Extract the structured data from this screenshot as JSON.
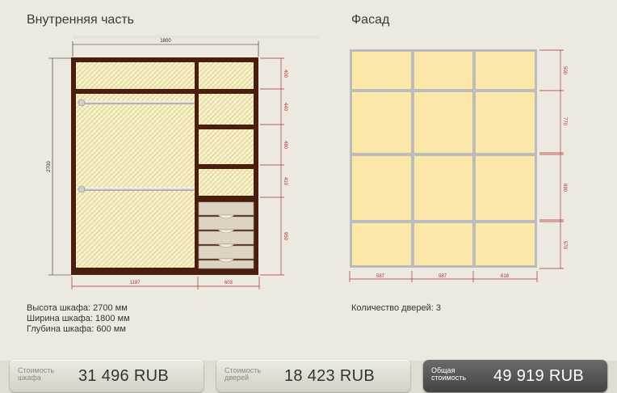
{
  "interior": {
    "title": "Внутренняя часть"
  },
  "facade": {
    "title": "Фасад"
  },
  "dimensions": {
    "interior_width": "1800",
    "interior_height": "2700",
    "bottom_left": "1197",
    "bottom_right": "603",
    "right_segments": [
      "400",
      "440",
      "480",
      "410",
      "950"
    ],
    "facade_right": [
      "500",
      "770",
      "890",
      "570"
    ],
    "facade_bottom": [
      "587",
      "587",
      "618"
    ]
  },
  "specs": {
    "height": "Высота шкафа: 2700 мм",
    "width": "Ширина шкафа: 1800 мм",
    "depth": "Глубина шкафа: 600 мм"
  },
  "doors_count": "Количество дверей: 3",
  "costs": {
    "cabinet": {
      "label1": "Стоимость",
      "label2": "шкафа",
      "value": "31 496  RUB"
    },
    "doors": {
      "label1": "Стоимость",
      "label2": "дверей",
      "value": "18 423  RUB"
    },
    "total": {
      "label1": "Общая",
      "label2": "стоимость",
      "value": "49 919  RUB"
    }
  },
  "colors": {
    "frame": "#4a1e0f",
    "panel": "#fbe8a8",
    "facade_frame": "#bdbcbc",
    "dim_line": "#b03030"
  }
}
